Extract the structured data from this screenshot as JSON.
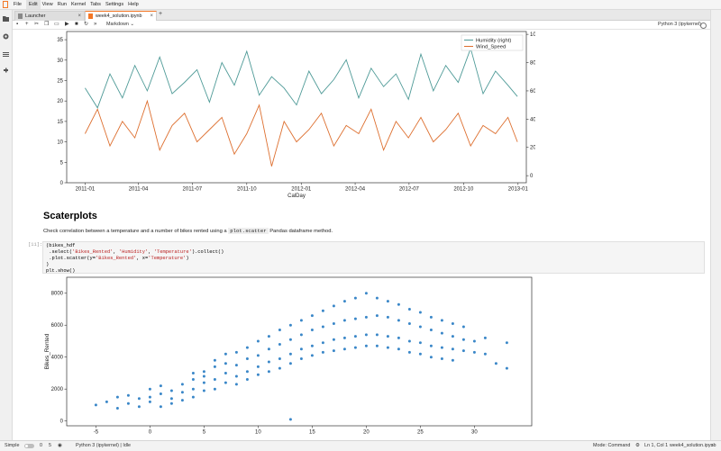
{
  "menubar": {
    "items": [
      "File",
      "Edit",
      "View",
      "Run",
      "Kernel",
      "Tabs",
      "Settings",
      "Help"
    ],
    "active": "Edit"
  },
  "tabs": [
    {
      "label": "Launcher",
      "icon": "launcher-icon"
    },
    {
      "label": "week4_solution.ipynb",
      "icon": "notebook-icon"
    }
  ],
  "toolbar": {
    "cell_type": "Markdown",
    "kernel": "Python 3 (ipykernel)"
  },
  "heading": "Scaterplots",
  "description": {
    "before": "Check correlation between a temperature and a number of bikes rented using a ",
    "code": "plot.scatter",
    "after": " Pandas dataframe method."
  },
  "cell": {
    "prompt": "[11]:",
    "lines": [
      "(bikes_hdf",
      " .select('Bikes_Rented', 'Humidity', 'Temperature').collect()",
      " .plot.scatter(y='Bikes_Rented', x='Temperature')",
      ")",
      "plt.show()"
    ]
  },
  "statusbar": {
    "mode_label": "Simple",
    "count_a": "0",
    "count_b": "5",
    "kernel_status": "Python 3 (ipykernel) | Idle",
    "mode": "Mode: Command",
    "position": "Ln 1, Col 1",
    "filename": "week4_solution.ipynb"
  },
  "colors": {
    "teal": "#4e9a97",
    "orange": "#dd6f2f",
    "scatter": "#3a87c8",
    "accent": "#f37726"
  },
  "chart_data": [
    {
      "type": "line",
      "title": "",
      "xlabel": "CalDay",
      "ylabel": "",
      "x_range": [
        "2010-12-01",
        "2013-01-15"
      ],
      "xticks": [
        "2011-01",
        "2011-04",
        "2011-07",
        "2011-10",
        "2012-01",
        "2012-04",
        "2012-07",
        "2012-10",
        "2013-01"
      ],
      "ylim_left": [
        0,
        37
      ],
      "yticks_left": [
        0,
        5,
        10,
        15,
        20,
        25,
        30,
        35
      ],
      "ylim_right": [
        -5,
        102
      ],
      "yticks_right": [
        0,
        20,
        40,
        60,
        80,
        100
      ],
      "legend": "top-right",
      "series": [
        {
          "name": "Humidity (right)",
          "axis": "right",
          "color": "#4e9a97",
          "x": [
            "2011-01-01",
            "2011-01-22",
            "2011-02-12",
            "2011-03-05",
            "2011-03-26",
            "2011-04-16",
            "2011-05-07",
            "2011-05-28",
            "2011-06-18",
            "2011-07-09",
            "2011-07-30",
            "2011-08-20",
            "2011-09-10",
            "2011-10-01",
            "2011-10-22",
            "2011-11-12",
            "2011-12-03",
            "2011-12-24",
            "2012-01-14",
            "2012-02-04",
            "2012-02-25",
            "2012-03-17",
            "2012-04-07",
            "2012-04-28",
            "2012-05-19",
            "2012-06-09",
            "2012-06-30",
            "2012-07-21",
            "2012-08-11",
            "2012-09-01",
            "2012-09-22",
            "2012-10-13",
            "2012-11-03",
            "2012-11-24",
            "2012-12-15",
            "2012-12-31"
          ],
          "values": [
            62,
            48,
            72,
            55,
            78,
            60,
            84,
            58,
            66,
            75,
            52,
            80,
            64,
            88,
            57,
            70,
            62,
            50,
            74,
            58,
            68,
            82,
            55,
            76,
            63,
            72,
            54,
            86,
            60,
            78,
            66,
            90,
            58,
            74,
            64,
            56
          ]
        },
        {
          "name": "Wind_Speed",
          "axis": "left",
          "color": "#dd6f2f",
          "x": [
            "2011-01-01",
            "2011-01-22",
            "2011-02-12",
            "2011-03-05",
            "2011-03-26",
            "2011-04-16",
            "2011-05-07",
            "2011-05-28",
            "2011-06-18",
            "2011-07-09",
            "2011-07-30",
            "2011-08-20",
            "2011-09-10",
            "2011-10-01",
            "2011-10-22",
            "2011-11-12",
            "2011-12-03",
            "2011-12-24",
            "2012-01-14",
            "2012-02-04",
            "2012-02-25",
            "2012-03-17",
            "2012-04-07",
            "2012-04-28",
            "2012-05-19",
            "2012-06-09",
            "2012-06-30",
            "2012-07-21",
            "2012-08-11",
            "2012-09-01",
            "2012-09-22",
            "2012-10-13",
            "2012-11-03",
            "2012-11-24",
            "2012-12-15",
            "2012-12-31"
          ],
          "values": [
            12,
            18,
            9,
            15,
            11,
            20,
            8,
            14,
            17,
            10,
            13,
            16,
            7,
            12,
            19,
            4,
            15,
            10,
            13,
            17,
            9,
            14,
            12,
            18,
            8,
            15,
            11,
            16,
            10,
            13,
            17,
            9,
            14,
            12,
            16,
            10
          ]
        }
      ]
    },
    {
      "type": "scatter",
      "title": "",
      "xlabel": "",
      "ylabel": "Bikes_Rented",
      "xlim": [
        -7.7,
        35.3
      ],
      "ylim": [
        -300,
        9000
      ],
      "xticks": [
        -5,
        0,
        5,
        10,
        15,
        20,
        25,
        30
      ],
      "yticks": [
        0,
        2000,
        4000,
        6000,
        8000
      ],
      "color": "#3a87c8",
      "points": [
        [
          -5,
          1000
        ],
        [
          -4,
          1200
        ],
        [
          -3,
          1500
        ],
        [
          -3,
          800
        ],
        [
          -2,
          1600
        ],
        [
          -2,
          1100
        ],
        [
          -1,
          1400
        ],
        [
          -1,
          900
        ],
        [
          0,
          1500
        ],
        [
          0,
          2000
        ],
        [
          0,
          1200
        ],
        [
          1,
          1700
        ],
        [
          1,
          900
        ],
        [
          1,
          2200
        ],
        [
          2,
          1400
        ],
        [
          2,
          1900
        ],
        [
          2,
          1100
        ],
        [
          3,
          1800
        ],
        [
          3,
          2300
        ],
        [
          3,
          1300
        ],
        [
          4,
          2000
        ],
        [
          4,
          2600
        ],
        [
          4,
          1500
        ],
        [
          4,
          3000
        ],
        [
          5,
          2400
        ],
        [
          5,
          1900
        ],
        [
          5,
          3100
        ],
        [
          5,
          2800
        ],
        [
          6,
          2600
        ],
        [
          6,
          3400
        ],
        [
          6,
          2000
        ],
        [
          6,
          3800
        ],
        [
          7,
          3000
        ],
        [
          7,
          2400
        ],
        [
          7,
          3600
        ],
        [
          7,
          4200
        ],
        [
          8,
          2800
        ],
        [
          8,
          3500
        ],
        [
          8,
          4300
        ],
        [
          8,
          2300
        ],
        [
          9,
          3100
        ],
        [
          9,
          3900
        ],
        [
          9,
          4600
        ],
        [
          9,
          2600
        ],
        [
          10,
          3400
        ],
        [
          10,
          4100
        ],
        [
          10,
          5000
        ],
        [
          10,
          2900
        ],
        [
          11,
          3700
        ],
        [
          11,
          4500
        ],
        [
          11,
          5300
        ],
        [
          11,
          3100
        ],
        [
          12,
          3900
        ],
        [
          12,
          4800
        ],
        [
          12,
          5700
        ],
        [
          12,
          3300
        ],
        [
          13,
          4200
        ],
        [
          13,
          5100
        ],
        [
          13,
          6000
        ],
        [
          13,
          3600
        ],
        [
          13,
          100
        ],
        [
          14,
          4500
        ],
        [
          14,
          5400
        ],
        [
          14,
          6300
        ],
        [
          14,
          3900
        ],
        [
          15,
          4700
        ],
        [
          15,
          5700
        ],
        [
          15,
          6600
        ],
        [
          15,
          4100
        ],
        [
          16,
          4900
        ],
        [
          16,
          5900
        ],
        [
          16,
          6900
        ],
        [
          16,
          4300
        ],
        [
          17,
          5100
        ],
        [
          17,
          6100
        ],
        [
          17,
          7200
        ],
        [
          17,
          4400
        ],
        [
          18,
          5200
        ],
        [
          18,
          6300
        ],
        [
          18,
          7500
        ],
        [
          18,
          4500
        ],
        [
          19,
          5300
        ],
        [
          19,
          6400
        ],
        [
          19,
          7700
        ],
        [
          19,
          4600
        ],
        [
          20,
          5400
        ],
        [
          20,
          6500
        ],
        [
          20,
          8000
        ],
        [
          20,
          4700
        ],
        [
          21,
          5400
        ],
        [
          21,
          6600
        ],
        [
          21,
          7700
        ],
        [
          21,
          4700
        ],
        [
          22,
          5300
        ],
        [
          22,
          6500
        ],
        [
          22,
          7500
        ],
        [
          22,
          4600
        ],
        [
          23,
          5200
        ],
        [
          23,
          6300
        ],
        [
          23,
          7300
        ],
        [
          23,
          4500
        ],
        [
          24,
          5000
        ],
        [
          24,
          6100
        ],
        [
          24,
          7000
        ],
        [
          24,
          4300
        ],
        [
          25,
          4900
        ],
        [
          25,
          5900
        ],
        [
          25,
          6800
        ],
        [
          25,
          4200
        ],
        [
          26,
          4700
        ],
        [
          26,
          5700
        ],
        [
          26,
          6500
        ],
        [
          26,
          4000
        ],
        [
          27,
          4600
        ],
        [
          27,
          5500
        ],
        [
          27,
          6300
        ],
        [
          27,
          3900
        ],
        [
          28,
          4500
        ],
        [
          28,
          5300
        ],
        [
          28,
          6100
        ],
        [
          28,
          3800
        ],
        [
          29,
          4400
        ],
        [
          29,
          5100
        ],
        [
          29,
          5900
        ],
        [
          30,
          4300
        ],
        [
          30,
          5000
        ],
        [
          31,
          4200
        ],
        [
          31,
          5200
        ],
        [
          32,
          3600
        ],
        [
          33,
          4900
        ],
        [
          33,
          3300
        ]
      ]
    }
  ]
}
